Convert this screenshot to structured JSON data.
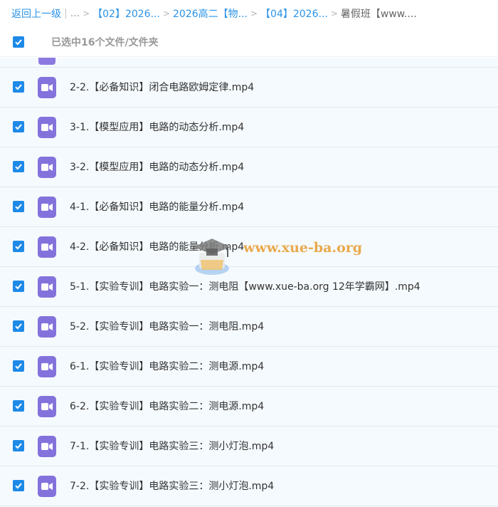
{
  "breadcrumb": {
    "back_label": "返回上一级",
    "pipe": "|",
    "ellipsis": "...",
    "sep": ">",
    "items": [
      "【02】2026...",
      "2026高二【物...",
      "【04】2026..."
    ],
    "current": "暑假班【www...."
  },
  "selection": {
    "text": "已选中16个文件/文件夹",
    "all_checked": true
  },
  "files": [
    {
      "name": "2-2.【必备知识】闭合电路欧姆定律.mp4",
      "checked": true
    },
    {
      "name": "3-1.【模型应用】电路的动态分析.mp4",
      "checked": true
    },
    {
      "name": "3-2.【模型应用】电路的动态分析.mp4",
      "checked": true
    },
    {
      "name": "4-1.【必备知识】电路的能量分析.mp4",
      "checked": true
    },
    {
      "name": "4-2.【必备知识】电路的能量分析.mp4",
      "checked": true
    },
    {
      "name": "5-1.【实验专训】电路实验一：测电阻【www.xue-ba.org 12年学霸网】.mp4",
      "checked": true
    },
    {
      "name": "5-2.【实验专训】电路实验一：测电阻.mp4",
      "checked": true
    },
    {
      "name": "6-1.【实验专训】电路实验二：测电源.mp4",
      "checked": true
    },
    {
      "name": "6-2.【实验专训】电路实验二：测电源.mp4",
      "checked": true
    },
    {
      "name": "7-1.【实验专训】电路实验三：测小灯泡.mp4",
      "checked": true
    },
    {
      "name": "7-2.【实验专训】电路实验三：测小灯泡.mp4",
      "checked": true
    }
  ],
  "file_icon": "video-file-icon",
  "watermark": {
    "text": "www.xue-ba.org",
    "icon": "graduation-cap-logo"
  },
  "colors": {
    "accent": "#1e8ae8",
    "link": "#2a93e8",
    "file_icon": "#8472dc",
    "row_bg": "#f5fafe",
    "watermark": "#e8a33d"
  }
}
